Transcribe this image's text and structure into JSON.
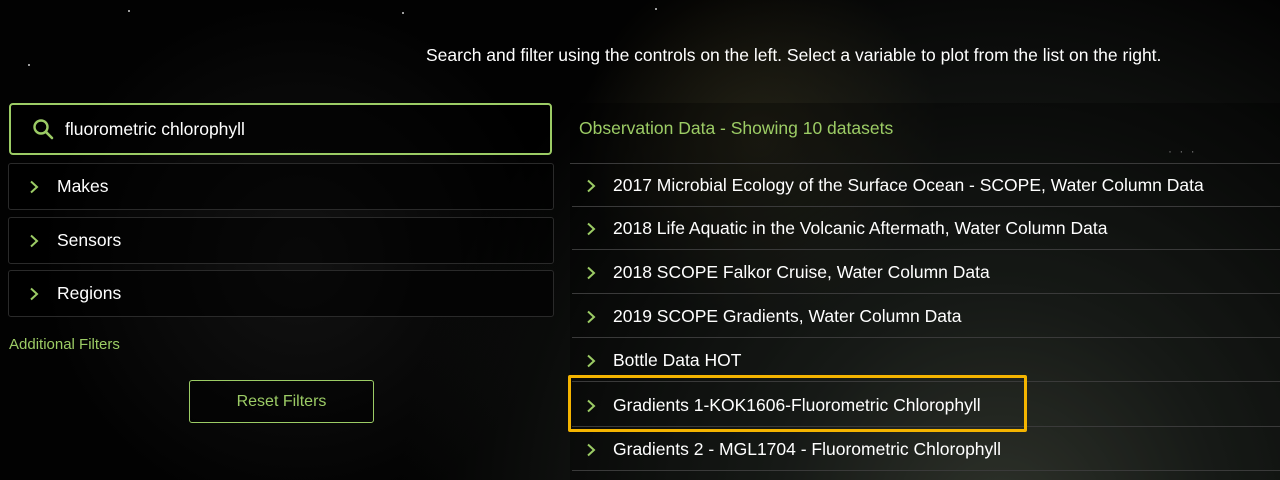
{
  "instructions": "Search and filter using the controls on the left. Select a variable to plot from the list on the right.",
  "search": {
    "icon": "search-icon",
    "value": "fluorometric chlorophyll"
  },
  "filters": [
    {
      "label": "Makes",
      "icon": "chevron-right-icon"
    },
    {
      "label": "Sensors",
      "icon": "chevron-right-icon"
    },
    {
      "label": "Regions",
      "icon": "chevron-right-icon"
    }
  ],
  "additional_filters_label": "Additional Filters",
  "reset_button_label": "Reset Filters",
  "results": {
    "header": "Observation Data - Showing 10 datasets",
    "items": [
      {
        "label": "2017 Microbial Ecology of the Surface Ocean - SCOPE, Water Column Data"
      },
      {
        "label": "2018 Life Aquatic in the Volcanic Aftermath, Water Column Data"
      },
      {
        "label": "2018 SCOPE Falkor Cruise, Water Column Data"
      },
      {
        "label": "2019 SCOPE Gradients, Water Column Data"
      },
      {
        "label": "Bottle Data HOT"
      },
      {
        "label": "Gradients 1-KOK1606-Fluorometric Chlorophyll",
        "highlighted": true
      },
      {
        "label": "Gradients 2 - MGL1704 - Fluorometric Chlorophyll"
      }
    ]
  },
  "colors": {
    "accent": "#9ccc65",
    "highlight": "#f4b400",
    "text": "#ffffff",
    "background": "#000000"
  }
}
